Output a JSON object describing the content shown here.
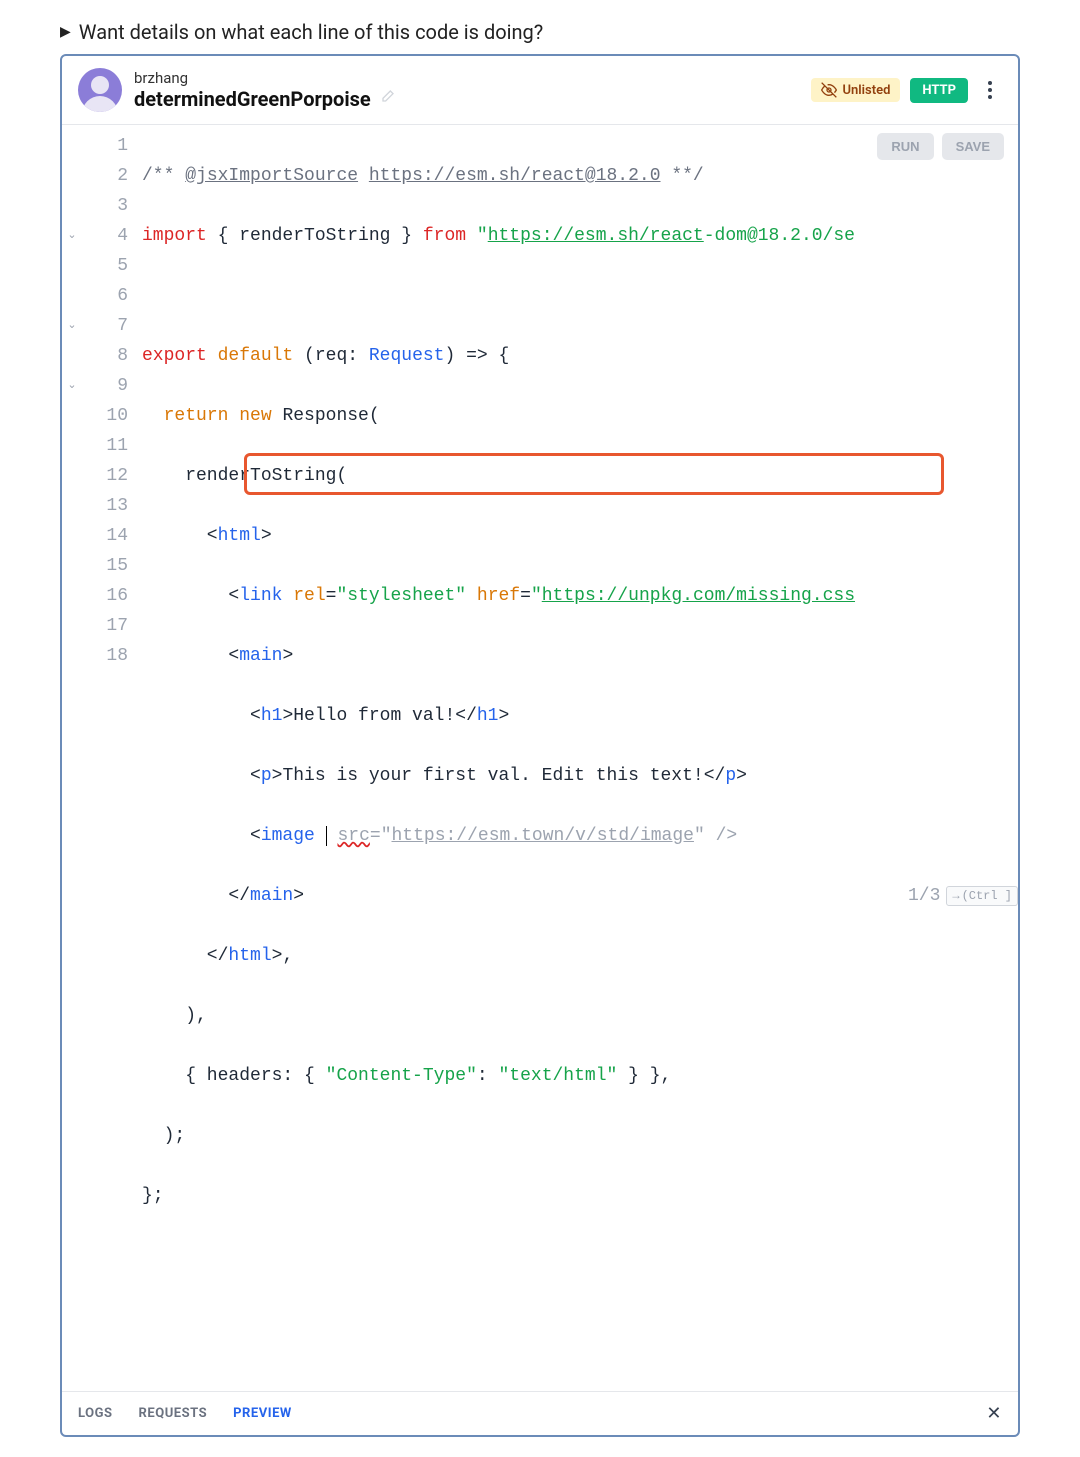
{
  "details_toggle": "Want details on what each line of this code is doing?",
  "header": {
    "username": "brzhang",
    "val_name": "determinedGreenPorpoise",
    "unlisted_label": "Unlisted",
    "http_label": "HTTP"
  },
  "buttons": {
    "run": "RUN",
    "save": "SAVE"
  },
  "gutter_lines": [
    "1",
    "2",
    "3",
    "4",
    "5",
    "6",
    "7",
    "8",
    "9",
    "10",
    "11",
    "12",
    "13",
    "14",
    "15",
    "16",
    "17",
    "18"
  ],
  "fold_lines": {
    "4": "⌄",
    "7": "⌄",
    "9": "⌄"
  },
  "code": {
    "l1_a": "/** ",
    "l1_b": "@jsxImportSource",
    "l1_c": " ",
    "l1_d": "https://esm.sh/react@18.2.0",
    "l1_e": " **/",
    "l2_a": "import",
    "l2_b": " { renderToString } ",
    "l2_c": "from",
    "l2_d": " ",
    "l2_e": "\"",
    "l2_f": "https://esm.sh/react",
    "l2_g": "-dom@18.2.0/se",
    "l4_a": "export",
    "l4_b": " ",
    "l4_c": "default",
    "l4_d": " (req: ",
    "l4_e": "Request",
    "l4_f": ") => {",
    "l5_a": "  ",
    "l5_b": "return",
    "l5_c": " ",
    "l5_d": "new",
    "l5_e": " Response(",
    "l6_a": "    renderToString(",
    "l7_a": "      <",
    "l7_b": "html",
    "l7_c": ">",
    "l8_a": "        <",
    "l8_b": "link",
    "l8_c": " ",
    "l8_d": "rel",
    "l8_e": "=",
    "l8_f": "\"stylesheet\"",
    "l8_g": " ",
    "l8_h": "href",
    "l8_i": "=",
    "l8_j": "\"",
    "l8_k": "https://unpkg.com/missing.css",
    "l9_a": "        <",
    "l9_b": "main",
    "l9_c": ">",
    "l10_a": "          <",
    "l10_b": "h1",
    "l10_c": ">Hello from val!</",
    "l10_d": "h1",
    "l10_e": ">",
    "l11_a": "          <",
    "l11_b": "p",
    "l11_c": ">This is your first val. Edit this text!</",
    "l11_d": "p",
    "l11_e": ">",
    "l12_a": "          <",
    "l12_b": "image",
    "l12_c": " ",
    "l12_sp": " ",
    "l12_d": "src",
    "l12_e": "=",
    "l12_f": "\"",
    "l12_g": "https://esm.town/v/std/image",
    "l12_h": "\"",
    "l12_i": " />",
    "l13_a": "        </",
    "l13_b": "main",
    "l13_c": ">",
    "l14_a": "      </",
    "l14_b": "html",
    "l14_c": ">,",
    "l15_a": "    ),",
    "l16_a": "    { headers: { ",
    "l16_b": "\"Content-Type\"",
    "l16_c": ": ",
    "l16_d": "\"text/html\"",
    "l16_e": " } },",
    "l17_a": "  );",
    "l18_a": "};"
  },
  "snippet": {
    "counter": "1/3",
    "hint_arrow": "→",
    "hint_key": "(Ctrl ]"
  },
  "tabs": {
    "logs": "LOGS",
    "requests": "REQUESTS",
    "preview": "PREVIEW"
  }
}
